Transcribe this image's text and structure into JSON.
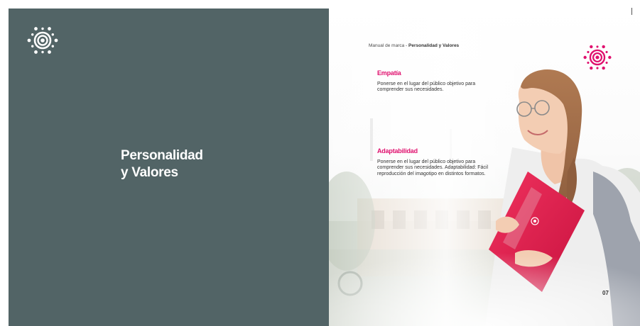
{
  "left_page": {
    "logo_icon": "sun-flower-logo-icon",
    "title_line1": "Personalidad",
    "title_line2": "y Valores",
    "background_color": "#526466"
  },
  "right_page": {
    "header_prefix": "Manual de marca - ",
    "header_bold": "Personalidad y Valores",
    "logo_icon": "sun-flower-logo-icon",
    "accent_color": "#e0106e",
    "values": [
      {
        "title": "Empatía",
        "text": "Ponerse en el lugar del público objetivo para comprender sus necesidades."
      },
      {
        "title": "Adaptabilidad",
        "text": "Ponerse en el lugar del público objetivo para comprender sus necesidades. Adaptabilidad: Fácil reproducción del imagotipo en distintos formatos."
      }
    ],
    "photo": "student-girl-holding-pink-folder-photo",
    "page_number": "07"
  }
}
